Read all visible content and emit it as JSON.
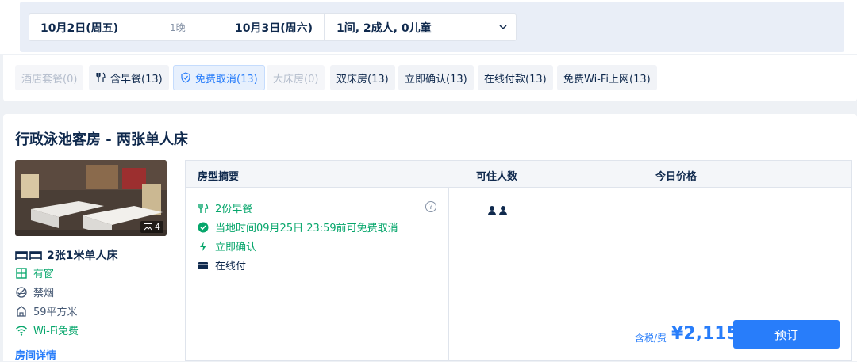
{
  "search": {
    "checkin": "10月2日(周五)",
    "nights": "1晚",
    "checkout": "10月3日(周六)",
    "guests": "1间, 2成人, 0儿童"
  },
  "filters": [
    {
      "label": "酒店套餐(0)",
      "state": "disabled"
    },
    {
      "label": "含早餐(13)",
      "state": "normal",
      "icon": "utensils-icon"
    },
    {
      "label": "免费取消(13)",
      "state": "active",
      "icon": "shield-icon"
    },
    {
      "label": "大床房(0)",
      "state": "disabled"
    },
    {
      "label": "双床房(13)",
      "state": "normal"
    },
    {
      "label": "立即确认(13)",
      "state": "normal"
    },
    {
      "label": "在线付款(13)",
      "state": "normal"
    },
    {
      "label": "免费Wi-Fi上网(13)",
      "state": "normal"
    }
  ],
  "room": {
    "title": "行政泳池客房 - 两张单人床",
    "photo_count": "4",
    "bed": "2张1米单人床",
    "amenities": [
      {
        "label": "有窗",
        "icon": "window-icon",
        "color": "green"
      },
      {
        "label": "禁烟",
        "icon": "no-smoking-icon",
        "color": "gray"
      },
      {
        "label": "59平方米",
        "icon": "area-icon",
        "color": "gray"
      },
      {
        "label": "Wi-Fi免费",
        "icon": "wifi-icon",
        "color": "green"
      }
    ],
    "details_link": "房间详情"
  },
  "table": {
    "headers": {
      "summary": "房型摘要",
      "occupancy": "可住人数",
      "price": "今日价格"
    },
    "features": [
      {
        "label": "2份早餐",
        "icon": "utensils-icon",
        "color": "green"
      },
      {
        "label": "当地时间09月25日 23:59前可免费取消",
        "icon": "check-circle-icon",
        "color": "green"
      },
      {
        "label": "立即确认",
        "icon": "lightning-icon",
        "color": "green"
      },
      {
        "label": "在线付",
        "icon": "card-icon",
        "color": "dark"
      }
    ],
    "help": "?",
    "price_label": "含税/费",
    "price": "¥2,115",
    "book": "预订"
  },
  "colors": {
    "accent": "#287dfa",
    "green": "#06a66b",
    "text": "#0f294d"
  }
}
